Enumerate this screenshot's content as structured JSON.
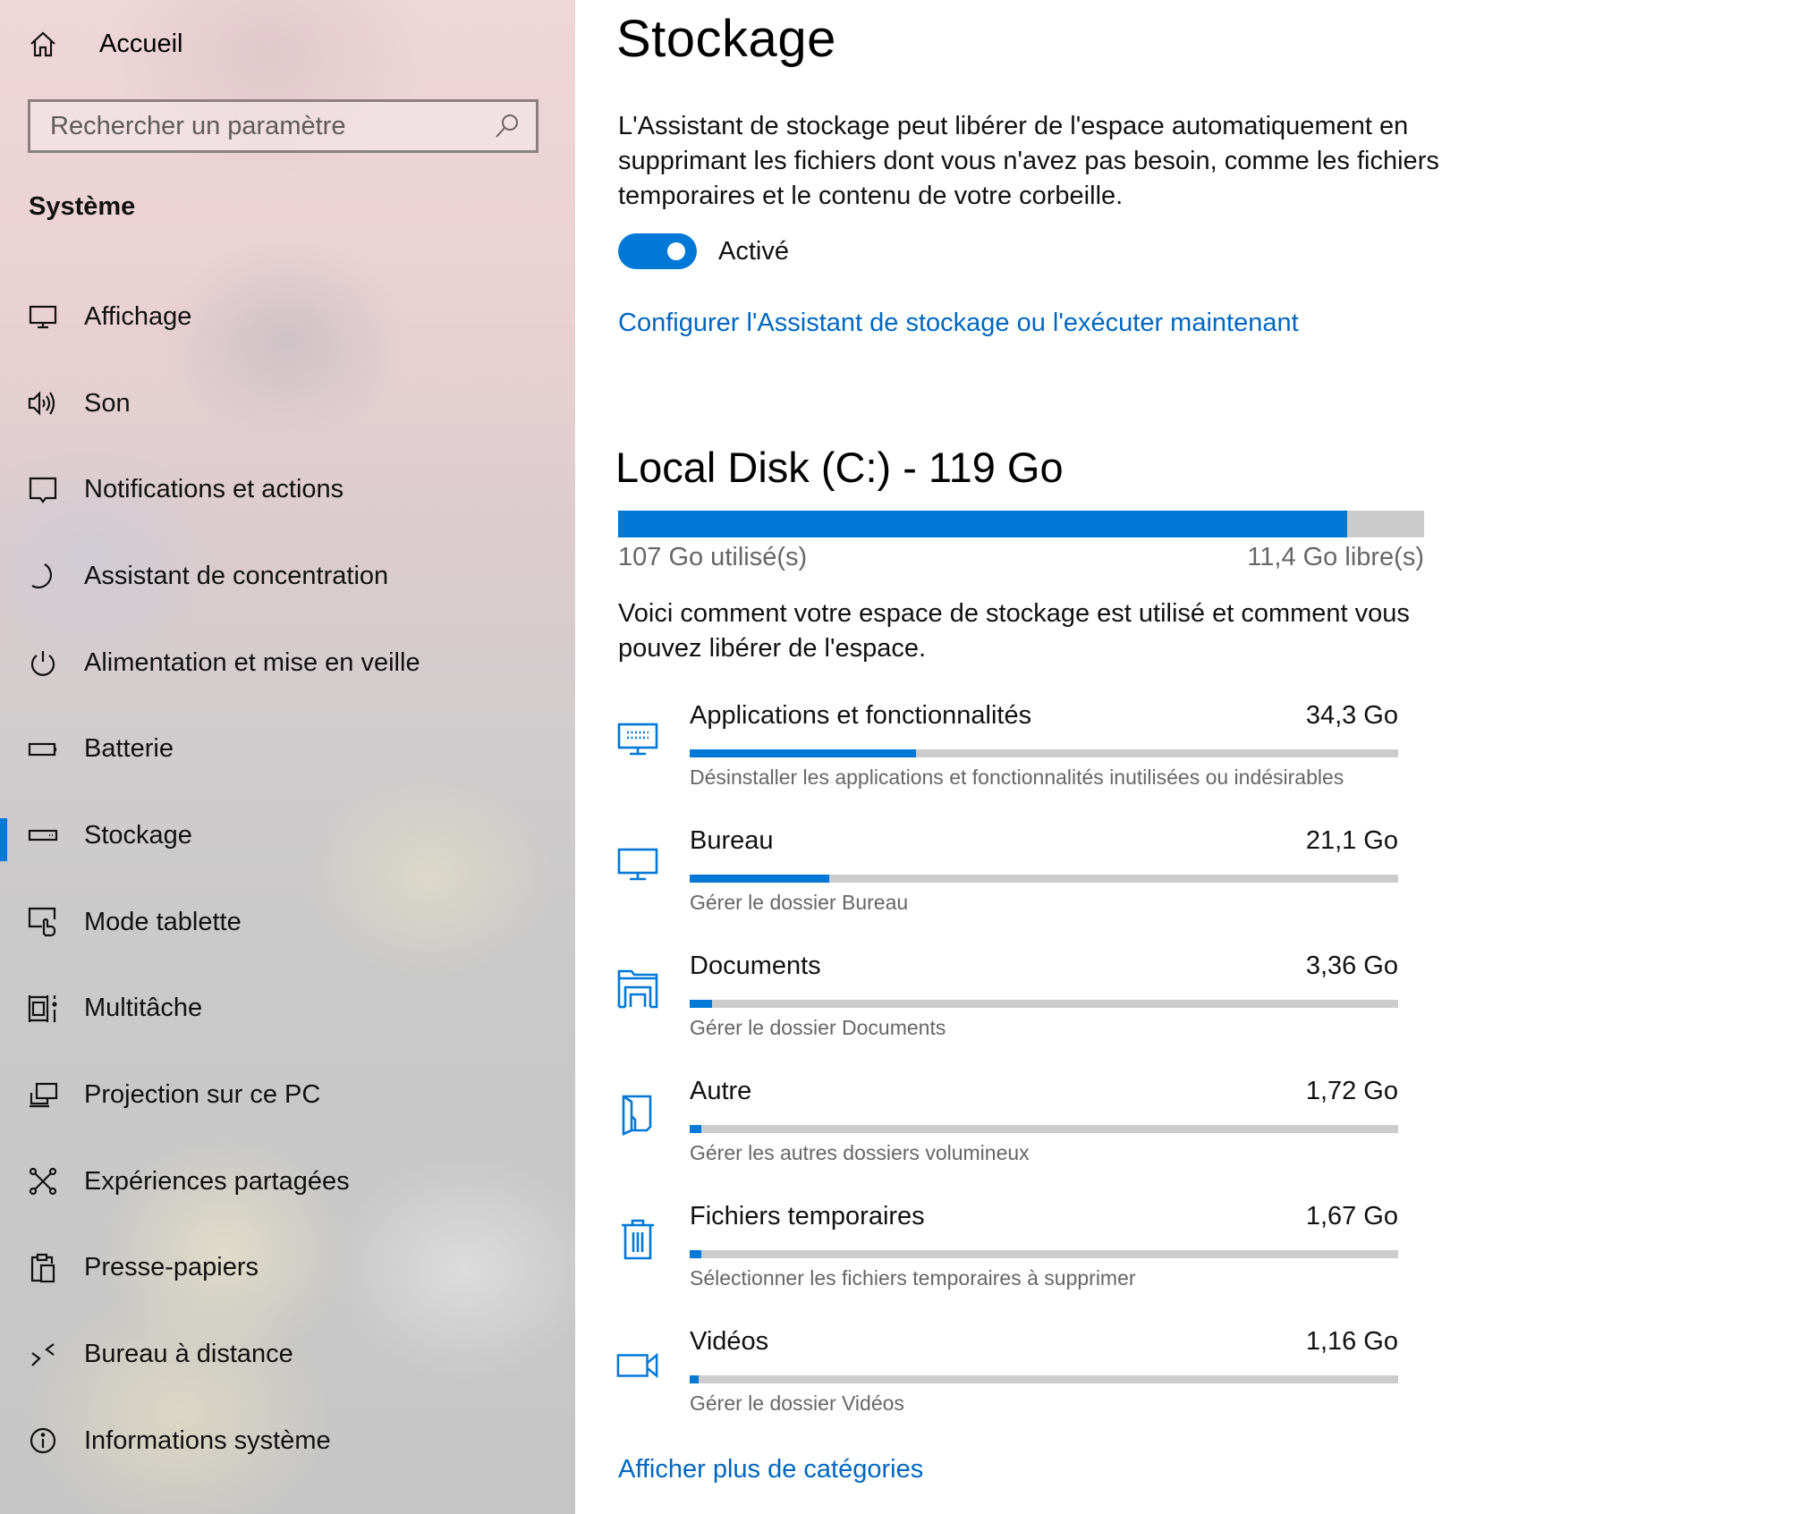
{
  "sidebar": {
    "home": {
      "label": "Accueil",
      "icon": "home-icon"
    },
    "search": {
      "placeholder": "Rechercher un paramètre",
      "value": "",
      "icon": "search-icon"
    },
    "section_title": "Système",
    "items": [
      {
        "label": "Affichage",
        "icon": "display-icon",
        "selected": false
      },
      {
        "label": "Son",
        "icon": "speaker-icon",
        "selected": false
      },
      {
        "label": "Notifications et actions",
        "icon": "notification-icon",
        "selected": false
      },
      {
        "label": "Assistant de concentration",
        "icon": "moon-icon",
        "selected": false
      },
      {
        "label": "Alimentation et mise en veille",
        "icon": "power-icon",
        "selected": false
      },
      {
        "label": "Batterie",
        "icon": "battery-icon",
        "selected": false
      },
      {
        "label": "Stockage",
        "icon": "storage-icon",
        "selected": true
      },
      {
        "label": "Mode tablette",
        "icon": "tablet-mode-icon",
        "selected": false
      },
      {
        "label": "Multitâche",
        "icon": "multitasking-icon",
        "selected": false
      },
      {
        "label": "Projection sur ce PC",
        "icon": "projection-icon",
        "selected": false
      },
      {
        "label": "Expériences partagées",
        "icon": "shared-experiences-icon",
        "selected": false
      },
      {
        "label": "Presse-papiers",
        "icon": "clipboard-icon",
        "selected": false
      },
      {
        "label": "Bureau à distance",
        "icon": "remote-desktop-icon",
        "selected": false
      },
      {
        "label": "Informations système",
        "icon": "info-icon",
        "selected": false
      }
    ]
  },
  "main": {
    "title": "Stockage",
    "description": "L'Assistant de stockage peut libérer de l'espace automatiquement en supprimant les fichiers dont vous n'avez pas besoin, comme les fichiers temporaires et le contenu de votre corbeille.",
    "toggle": {
      "state": true,
      "label": "Activé"
    },
    "configure_link": "Configurer l'Assistant de stockage ou l'exécuter maintenant",
    "disk": {
      "title": "Local Disk (C:) - 119 Go",
      "used_label": "107 Go utilisé(s)",
      "free_label": "11,4 Go libre(s)",
      "used_fraction": 0.904
    },
    "usage_description": "Voici comment votre espace de stockage est utilisé et comment vous pouvez libérer de l'espace.",
    "categories": [
      {
        "name": "Applications et fonctionnalités",
        "size": "34,3 Go",
        "fraction": 0.32,
        "subtitle": "Désinstaller les applications et fonctionnalités inutilisées ou indésirables",
        "icon": "apps-features-icon"
      },
      {
        "name": "Bureau",
        "size": "21,1 Go",
        "fraction": 0.197,
        "subtitle": "Gérer le dossier Bureau",
        "icon": "desktop-icon"
      },
      {
        "name": "Documents",
        "size": "3,36 Go",
        "fraction": 0.031,
        "subtitle": "Gérer le dossier Documents",
        "icon": "documents-icon"
      },
      {
        "name": "Autre",
        "size": "1,72 Go",
        "fraction": 0.016,
        "subtitle": "Gérer les autres dossiers volumineux",
        "icon": "other-folder-icon"
      },
      {
        "name": "Fichiers temporaires",
        "size": "1,67 Go",
        "fraction": 0.016,
        "subtitle": "Sélectionner les fichiers temporaires à supprimer",
        "icon": "trash-icon"
      },
      {
        "name": "Vidéos",
        "size": "1,16 Go",
        "fraction": 0.011,
        "subtitle": "Gérer le dossier Vidéos",
        "icon": "video-icon"
      }
    ],
    "more_link": "Afficher plus de catégories"
  },
  "colors": {
    "accent": "#0078d7",
    "link": "#0067c0",
    "bar_track": "#cccccc",
    "secondary_text": "#666666"
  }
}
